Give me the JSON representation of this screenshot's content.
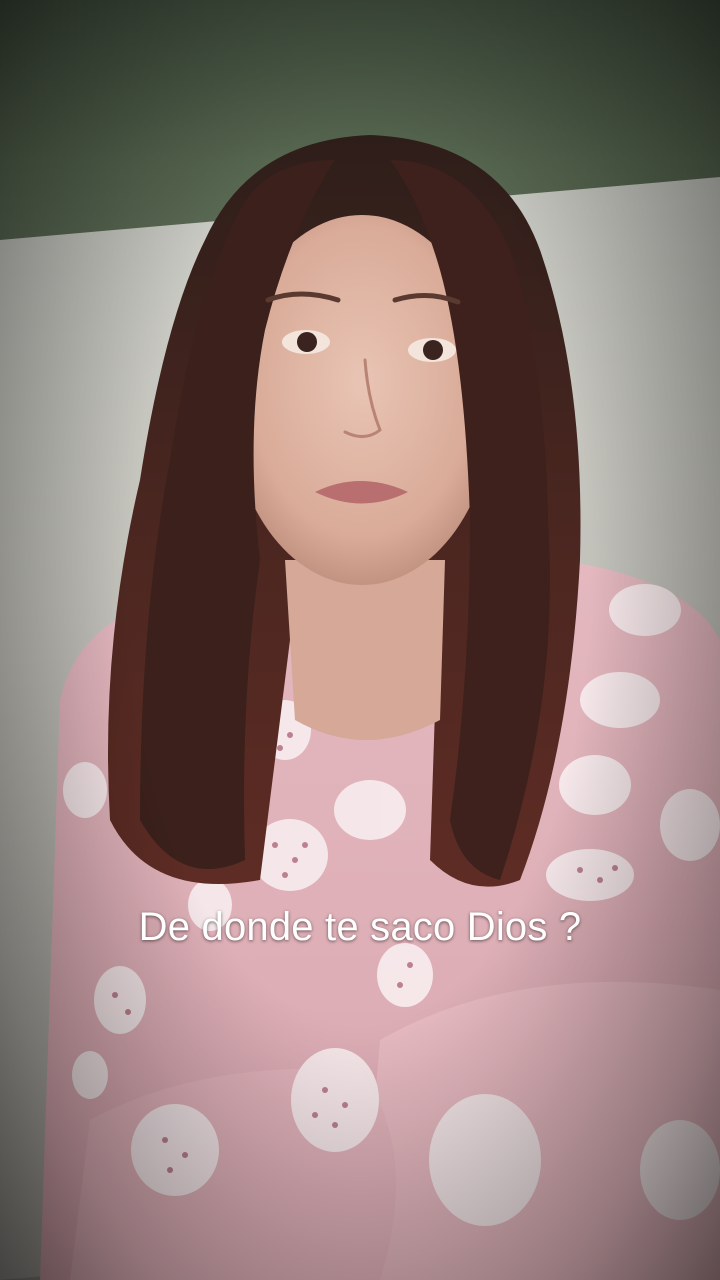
{
  "video": {
    "caption": "De donde te saco Dios ?"
  }
}
